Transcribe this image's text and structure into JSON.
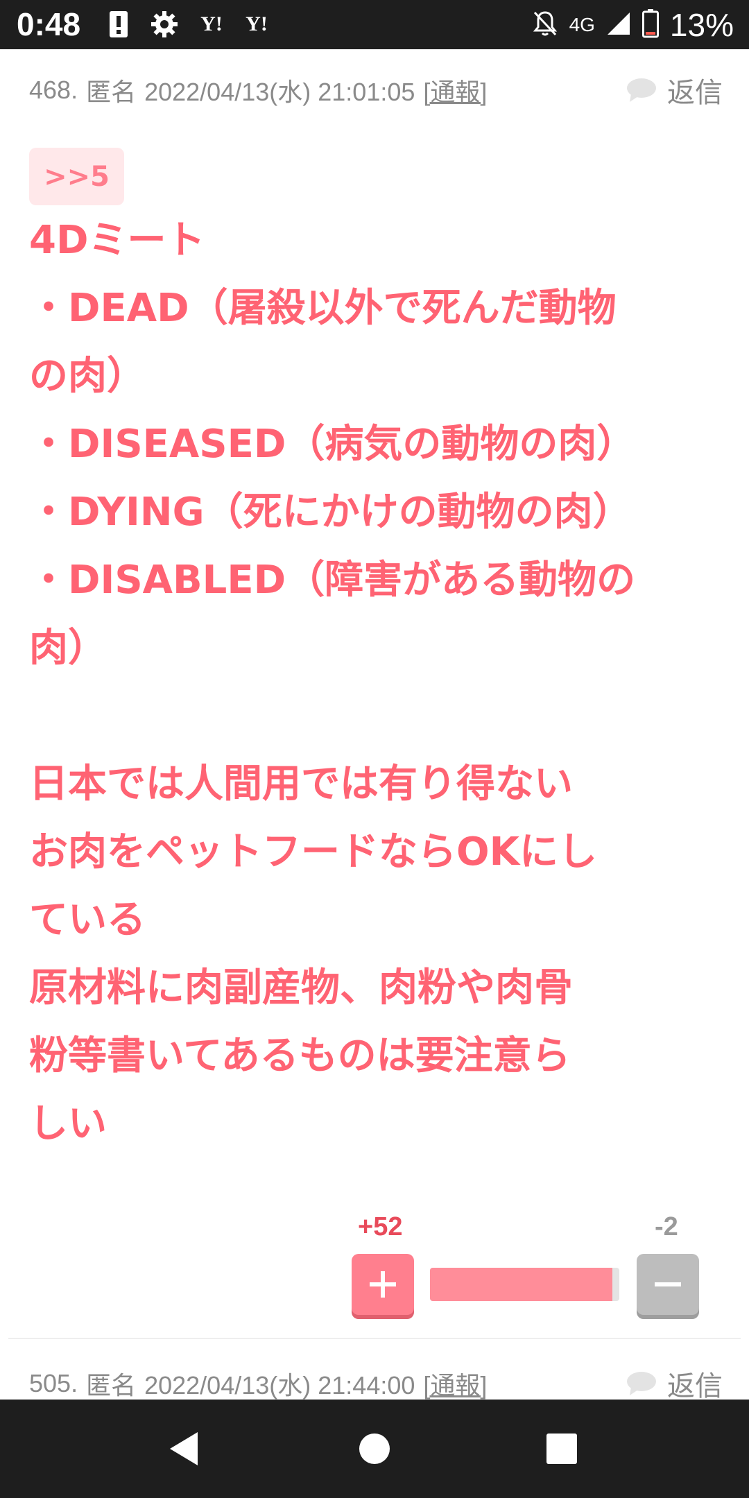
{
  "status_bar": {
    "time": "0:48",
    "network": "4G",
    "battery": "13%",
    "icons": [
      "alert-icon",
      "gear-icon",
      "yahoo-icon",
      "yahoo-icon",
      "notifications-off-icon",
      "signal-icon",
      "battery-icon"
    ],
    "yahoo_label": "Y!"
  },
  "post": {
    "number": "468.",
    "author": "匿名",
    "datetime": "2022/04/13(水) 21:01:05",
    "report": "[通報]",
    "reply": "返信",
    "anchor": ">>5",
    "lines": [
      "4Dミート",
      "・DEAD（屠殺以外で死んだ動物",
      "の肉）",
      "・DISEASED（病気の動物の肉）",
      "・DYING（死にかけの動物の肉）",
      "・DISABLED（障害がある動物の",
      "肉）",
      "",
      "日本では人間用では有り得ない",
      "お肉をペットフードならOKにし",
      "ている",
      "原材料に肉副産物、肉粉や肉骨",
      "粉等書いてあるものは要注意ら",
      "しい"
    ],
    "votes": {
      "plus": "+52",
      "minus": "-2",
      "plus_ratio": 0.963
    }
  },
  "next_post": {
    "number": "505.",
    "author": "匿名",
    "datetime": "2022/04/13(水) 21:44:00",
    "report": "[通報]",
    "reply": "返信"
  },
  "colors": {
    "accent": "#ff6373",
    "chip_bg": "#ffe8ea",
    "meta": "#8a8a8a"
  }
}
